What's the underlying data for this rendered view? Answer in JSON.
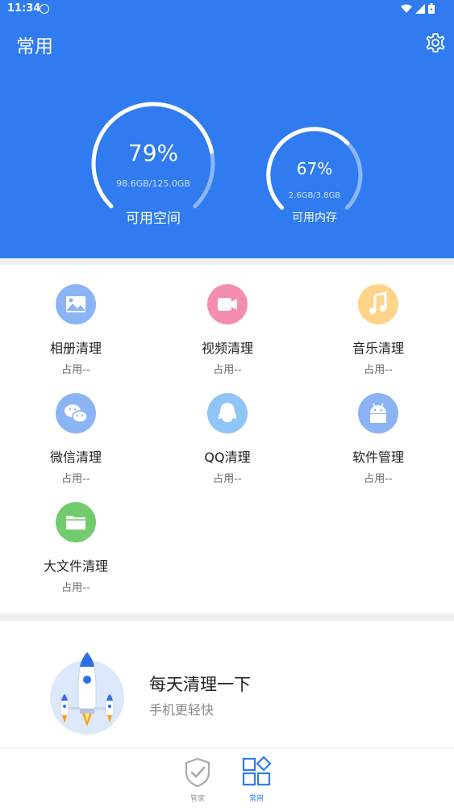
{
  "status": {
    "time": "11:34"
  },
  "header": {
    "title": "常用"
  },
  "storage": {
    "percent": "79%",
    "detail": "98.6GB/125.0GB",
    "label": "可用空间",
    "fraction": 0.79
  },
  "memory": {
    "percent": "67%",
    "detail": "2.6GB/3.8GB",
    "label": "可用内存",
    "fraction": 0.67
  },
  "tools": [
    {
      "name": "相册清理",
      "usage": "占用--",
      "icon": "photo-icon",
      "color": "#8bb4f4"
    },
    {
      "name": "视频清理",
      "usage": "占用--",
      "icon": "video-icon",
      "color": "#f48eb1"
    },
    {
      "name": "音乐清理",
      "usage": "占用--",
      "icon": "music-icon",
      "color": "#fdd48a"
    },
    {
      "name": "微信清理",
      "usage": "占用--",
      "icon": "wechat-icon",
      "color": "#8bb4f4"
    },
    {
      "name": "QQ清理",
      "usage": "占用--",
      "icon": "qq-icon",
      "color": "#8fc5f7"
    },
    {
      "name": "软件管理",
      "usage": "占用--",
      "icon": "android-icon",
      "color": "#8bb4f4"
    },
    {
      "name": "大文件清理",
      "usage": "占用--",
      "icon": "folder-icon",
      "color": "#72cc6e"
    }
  ],
  "promo": {
    "title": "每天清理一下",
    "subtitle": "手机更轻快"
  },
  "tabs": [
    {
      "label": "管家",
      "icon": "shield-check-icon",
      "active": false
    },
    {
      "label": "常用",
      "icon": "apps-grid-icon",
      "active": true
    }
  ],
  "colors": {
    "primary": "#2f7bef",
    "inactive": "#999999"
  }
}
